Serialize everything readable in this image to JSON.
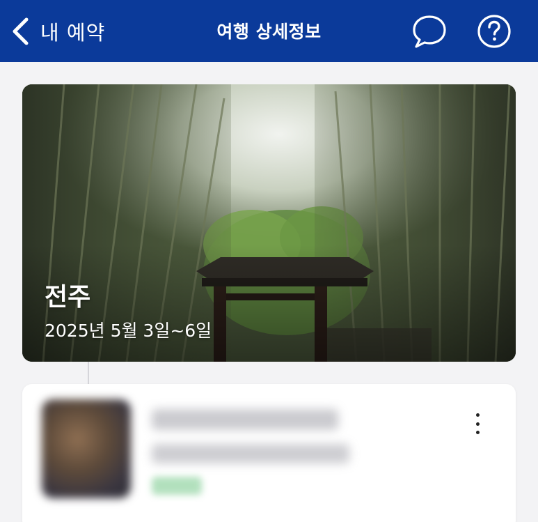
{
  "header": {
    "back_label": "내 예약",
    "title": "여행 상세정보",
    "back_icon": "chevron-left-icon",
    "chat_icon": "chat-bubble-icon",
    "help_icon": "help-circle-icon",
    "background_color": "#0b3a9a"
  },
  "trip": {
    "city": "전주",
    "dates": "2025년 5월 3일~6일"
  },
  "booking_card": {
    "menu_icon": "more-vertical-icon"
  }
}
